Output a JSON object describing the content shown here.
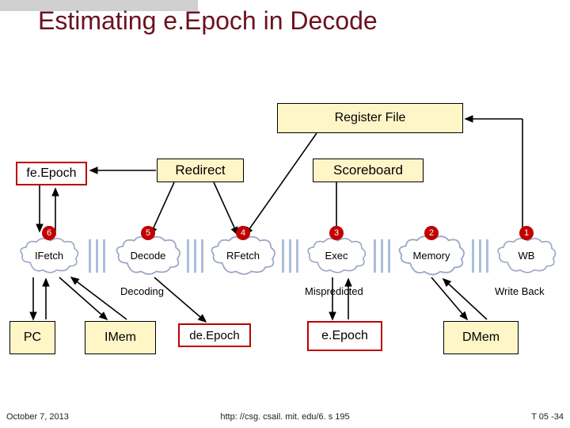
{
  "title": "Estimating e.Epoch in Decode",
  "labels": {
    "register_file": "Register File",
    "redirect": "Redirect",
    "scoreboard": "Scoreboard",
    "fe_epoch": "fe.Epoch",
    "de_epoch": "de.Epoch",
    "e_epoch": "e.Epoch",
    "pc": "PC",
    "imem": "IMem",
    "dmem": "DMem"
  },
  "stages": [
    {
      "num": "6",
      "name": "IFetch"
    },
    {
      "num": "5",
      "name": "Decode"
    },
    {
      "num": "4",
      "name": "RFetch"
    },
    {
      "num": "3",
      "name": "Exec"
    },
    {
      "num": "2",
      "name": "Memory"
    },
    {
      "num": "1",
      "name": "WB"
    }
  ],
  "annotations": {
    "decoding": "Decoding",
    "mispredicted": "Mispredicted",
    "write_back": "Write Back"
  },
  "footer": {
    "date": "October 7, 2013",
    "url": "http: //csg. csail. mit. edu/6. s 195",
    "page": "T 05 -34"
  },
  "colors": {
    "title": "#6b1220",
    "box_fill": "#fff6c8",
    "epoch_border": "#c00000",
    "badge": "#c00000",
    "pipe": "#aabedd"
  }
}
